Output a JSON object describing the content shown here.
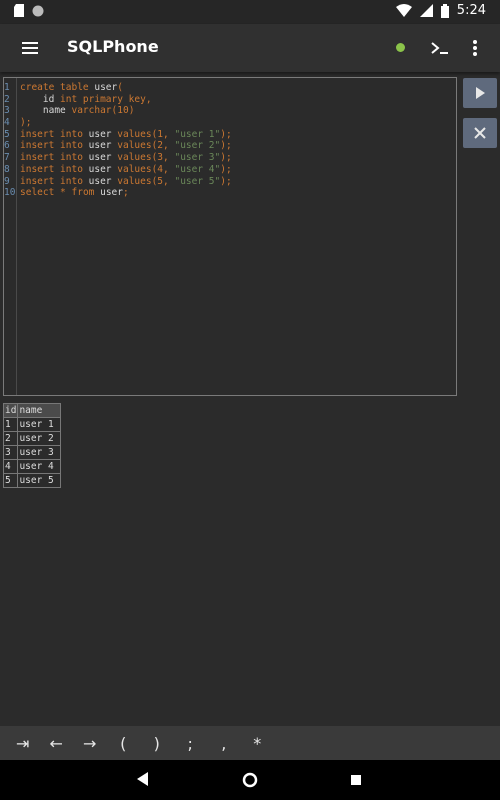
{
  "status_bar": {
    "time": "5:24",
    "left_icons": [
      "sd-card-icon",
      "circle-notification-icon"
    ],
    "right_icons": [
      "wifi-icon",
      "signal-icon",
      "battery-icon"
    ]
  },
  "app_bar": {
    "title": "SQLPhone",
    "connection_status_color": "#8bc34a",
    "icons": [
      "menu-icon",
      "terminal-icon",
      "more-vert-icon"
    ]
  },
  "editor": {
    "lines": [
      {
        "n": "1",
        "tokens": [
          {
            "t": "create table ",
            "c": "kw"
          },
          {
            "t": "user",
            "c": "txt"
          },
          {
            "t": "(",
            "c": "pn"
          }
        ]
      },
      {
        "n": "2",
        "tokens": [
          {
            "t": "    id ",
            "c": "txt"
          },
          {
            "t": "int primary key",
            "c": "kw"
          },
          {
            "t": ",",
            "c": "pn"
          }
        ]
      },
      {
        "n": "3",
        "tokens": [
          {
            "t": "    name ",
            "c": "txt"
          },
          {
            "t": "varchar",
            "c": "kw"
          },
          {
            "t": "(10)",
            "c": "pn"
          }
        ]
      },
      {
        "n": "4",
        "tokens": [
          {
            "t": ");",
            "c": "pn"
          }
        ]
      },
      {
        "n": "5",
        "tokens": [
          {
            "t": "insert into ",
            "c": "kw"
          },
          {
            "t": "user ",
            "c": "txt"
          },
          {
            "t": "values",
            "c": "kw"
          },
          {
            "t": "(1, ",
            "c": "pn"
          },
          {
            "t": "\"user 1\"",
            "c": "str"
          },
          {
            "t": ");",
            "c": "pn"
          }
        ]
      },
      {
        "n": "6",
        "tokens": [
          {
            "t": "insert into ",
            "c": "kw"
          },
          {
            "t": "user ",
            "c": "txt"
          },
          {
            "t": "values",
            "c": "kw"
          },
          {
            "t": "(2, ",
            "c": "pn"
          },
          {
            "t": "\"user 2\"",
            "c": "str"
          },
          {
            "t": ");",
            "c": "pn"
          }
        ]
      },
      {
        "n": "7",
        "tokens": [
          {
            "t": "insert into ",
            "c": "kw"
          },
          {
            "t": "user ",
            "c": "txt"
          },
          {
            "t": "values",
            "c": "kw"
          },
          {
            "t": "(3, ",
            "c": "pn"
          },
          {
            "t": "\"user 3\"",
            "c": "str"
          },
          {
            "t": ");",
            "c": "pn"
          }
        ]
      },
      {
        "n": "8",
        "tokens": [
          {
            "t": "insert into ",
            "c": "kw"
          },
          {
            "t": "user ",
            "c": "txt"
          },
          {
            "t": "values",
            "c": "kw"
          },
          {
            "t": "(4, ",
            "c": "pn"
          },
          {
            "t": "\"user 4\"",
            "c": "str"
          },
          {
            "t": ");",
            "c": "pn"
          }
        ]
      },
      {
        "n": "9",
        "tokens": [
          {
            "t": "insert into ",
            "c": "kw"
          },
          {
            "t": "user ",
            "c": "txt"
          },
          {
            "t": "values",
            "c": "kw"
          },
          {
            "t": "(5, ",
            "c": "pn"
          },
          {
            "t": "\"user 5\"",
            "c": "str"
          },
          {
            "t": ");",
            "c": "pn"
          }
        ]
      },
      {
        "n": "10",
        "tokens": [
          {
            "t": "select ",
            "c": "kw"
          },
          {
            "t": "* ",
            "c": "pn"
          },
          {
            "t": "from ",
            "c": "kw"
          },
          {
            "t": "user",
            "c": "txt"
          },
          {
            "t": ";",
            "c": "pn"
          }
        ]
      }
    ]
  },
  "actions": {
    "run_icon": "play-icon",
    "clear_icon": "close-icon",
    "button_color": "#5f6a7d"
  },
  "results": {
    "columns": [
      "id",
      "name"
    ],
    "rows": [
      [
        "1",
        "user 1"
      ],
      [
        "2",
        "user 2"
      ],
      [
        "3",
        "user 3"
      ],
      [
        "4",
        "user 4"
      ],
      [
        "5",
        "user 5"
      ]
    ]
  },
  "key_bar": {
    "keys": [
      "⇥",
      "←",
      "→",
      "(",
      ")",
      ";",
      ",",
      "*"
    ]
  },
  "nav_bar": {
    "icons": [
      "back-icon",
      "home-icon",
      "recents-icon"
    ]
  }
}
